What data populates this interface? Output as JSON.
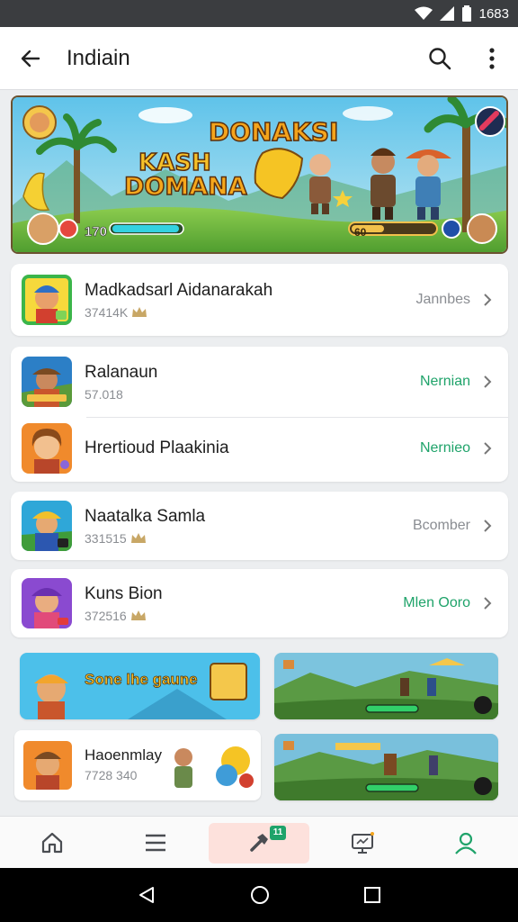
{
  "status_bar": {
    "time": "1683"
  },
  "app_bar": {
    "title": "Indiain"
  },
  "banner": {
    "title_top": "DONAKSI",
    "title_mid": "KASH",
    "title_bottom": "DOMANA",
    "score": "170",
    "energy": "60"
  },
  "featured": {
    "name": "Madkadsarl Aidanarakah",
    "sub": "37414K",
    "status": "Jannbes"
  },
  "group_rows": [
    {
      "name": "Ralanaun",
      "sub": "57.018",
      "status": "Nernian"
    },
    {
      "name": "Hrertioud Plaakinia",
      "sub": "",
      "status": "Nernieo"
    }
  ],
  "single_rows": [
    {
      "name": "Naatalka Samla",
      "sub": "331515",
      "status": "Bcomber"
    },
    {
      "name": "Kuns Bion",
      "sub": "372516",
      "status": "Mlen Ooro"
    }
  ],
  "tiles": {
    "promo": {
      "text": "Sone lhe gaune"
    },
    "small": {
      "name": "Haoenmlay",
      "sub": "7728 340"
    }
  },
  "colors": {
    "accent_green": "#1fa36a",
    "status_gray": "#8a8d92",
    "active_nav_bg": "#fde1dc"
  },
  "bottom_nav": {
    "items": [
      "home-icon",
      "menu-icon",
      "hammer-icon",
      "screen-icon",
      "profile-icon"
    ],
    "badge": "11",
    "active_index": 2
  }
}
